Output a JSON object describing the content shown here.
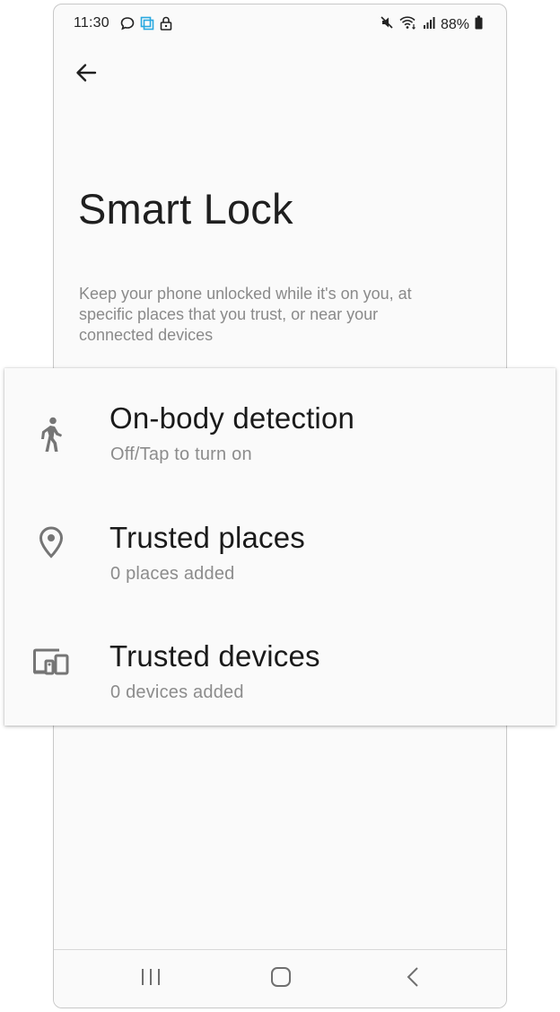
{
  "status_bar": {
    "time": "11:30",
    "battery": "88%",
    "left_icons": [
      "chat-bubble-icon",
      "screen-share-icon",
      "lock-icon"
    ],
    "right_icons": [
      "mute-icon",
      "wifi-icon",
      "signal-icon",
      "battery-icon"
    ]
  },
  "header": {
    "back_icon": "arrow-back-icon",
    "title": "Smart Lock",
    "description": "Keep your phone unlocked while it's on you, at specific places that you trust, or near your connected devices"
  },
  "options": [
    {
      "icon": "walking-person-icon",
      "title": "On-body detection",
      "subtitle": "Off/Tap to turn on"
    },
    {
      "icon": "location-pin-icon",
      "title": "Trusted places",
      "subtitle": "0 places added"
    },
    {
      "icon": "devices-icon",
      "title": "Trusted devices",
      "subtitle": "0 devices added"
    }
  ],
  "nav_bar": {
    "icons": [
      "recent-apps-icon",
      "home-icon",
      "back-nav-icon"
    ]
  },
  "colors": {
    "background": "#fafafa",
    "title_text": "#1f1f1f",
    "secondary_text": "#8a8a8a",
    "icon_gray": "#757575",
    "screen_share_accent": "#29a8e0"
  }
}
